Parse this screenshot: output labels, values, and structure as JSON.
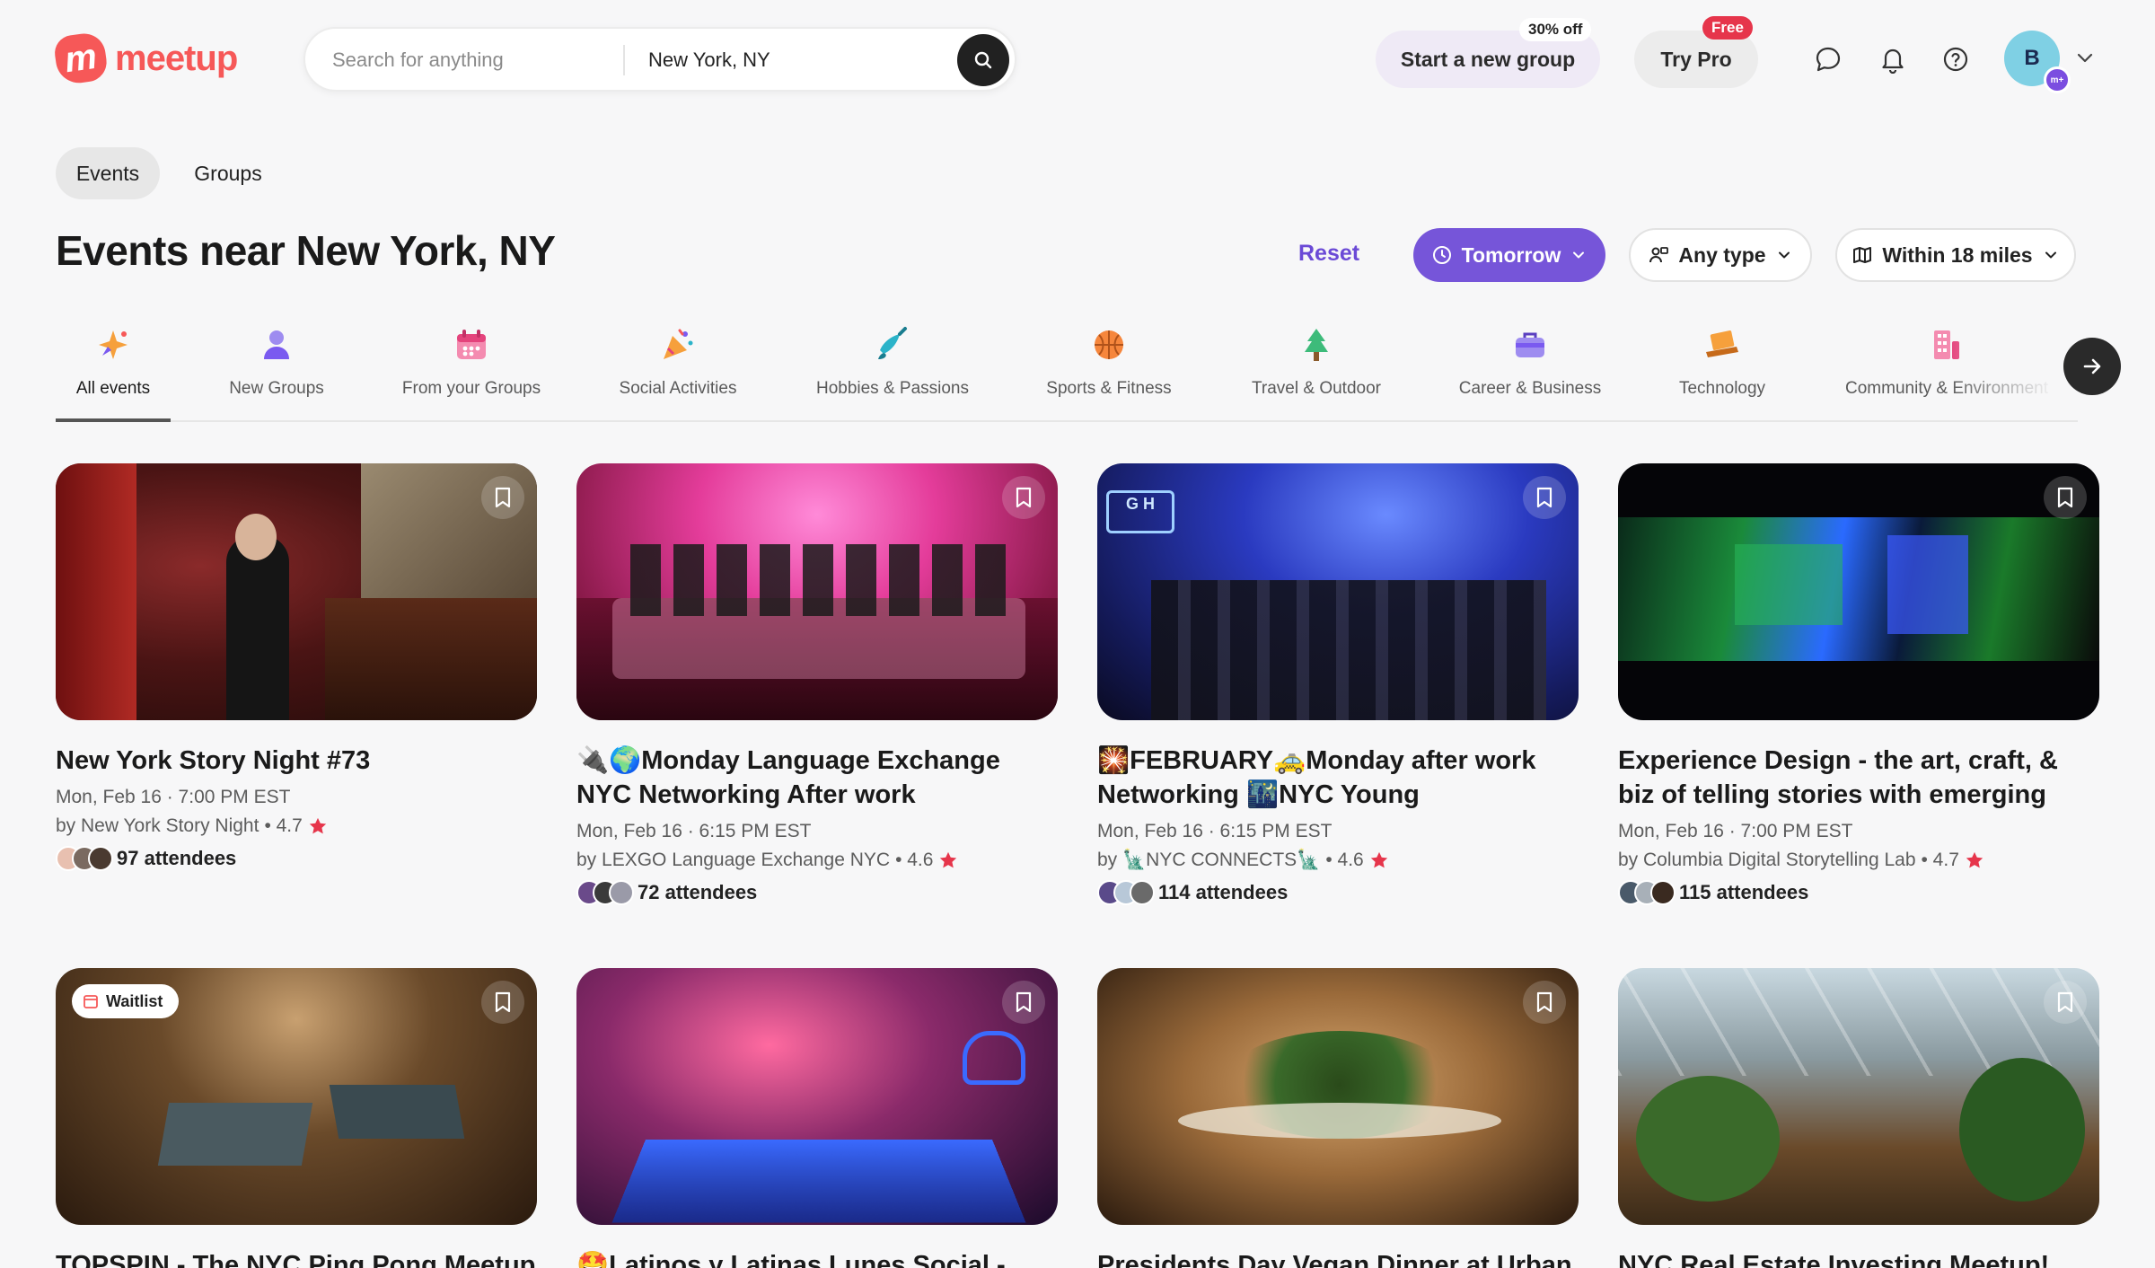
{
  "header": {
    "logo_text": "meetup",
    "logo_mark": "m",
    "search_placeholder": "Search for anything",
    "location": "New York, NY",
    "start_group": "Start a new group",
    "start_group_tag": "30% off",
    "try_pro": "Try Pro",
    "try_pro_tag": "Free",
    "avatar_initial": "B",
    "avatar_badge": "m+"
  },
  "tabs": {
    "events": "Events",
    "groups": "Groups"
  },
  "page_title": "Events near New York, NY",
  "filters": {
    "reset": "Reset",
    "date": "Tomorrow",
    "type": "Any type",
    "distance": "Within 18 miles"
  },
  "categories": [
    {
      "label": "All events",
      "icon": "sparkle-icon"
    },
    {
      "label": "New Groups",
      "icon": "person-icon"
    },
    {
      "label": "From your Groups",
      "icon": "calendar-icon"
    },
    {
      "label": "Social Activities",
      "icon": "party-icon"
    },
    {
      "label": "Hobbies & Passions",
      "icon": "paint-icon"
    },
    {
      "label": "Sports & Fitness",
      "icon": "ball-icon"
    },
    {
      "label": "Travel & Outdoor",
      "icon": "tree-icon"
    },
    {
      "label": "Career & Business",
      "icon": "briefcase-icon"
    },
    {
      "label": "Technology",
      "icon": "laptop-icon"
    },
    {
      "label": "Community & Environment",
      "icon": "building-icon"
    }
  ],
  "events": [
    {
      "title": "New York Story Night #73",
      "when": "Mon, Feb 16 · 7:00 PM EST",
      "host": "by New York Story Night",
      "rating": "• 4.7",
      "attendees": "97 attendees"
    },
    {
      "title": "🔌🌍Monday Language Exchange NYC Networking After work",
      "when": "Mon, Feb 16 · 6:15 PM EST",
      "host": "by LEXGO Language Exchange NYC",
      "rating": "• 4.6",
      "attendees": "72 attendees"
    },
    {
      "title": "🎇FEBRUARY🚕Monday after work Networking 🌃NYC Young Professional...",
      "when": "Mon, Feb 16 · 6:15 PM EST",
      "host": "by 🗽NYC CONNECTS🗽",
      "rating": "• 4.6",
      "attendees": "114 attendees"
    },
    {
      "title": "Experience Design - the art, craft, & biz of telling stories with emerging tech",
      "when": "Mon, Feb 16 · 7:00 PM EST",
      "host": "by Columbia Digital Storytelling Lab",
      "rating": "• 4.7",
      "attendees": "115 attendees"
    },
    {
      "title": "TOPSPIN - The NYC Ping Pong Meetup",
      "badge": "Waitlist"
    },
    {
      "title": "🤩Latinos y Latinas Lunes Social -"
    },
    {
      "title": "Presidents Day Vegan Dinner at Urban"
    },
    {
      "title": "NYC Real Estate Investing Meetup!"
    }
  ],
  "colors": {
    "brand": "#f65858",
    "accent": "#7655d9",
    "star": "#e6354b"
  }
}
